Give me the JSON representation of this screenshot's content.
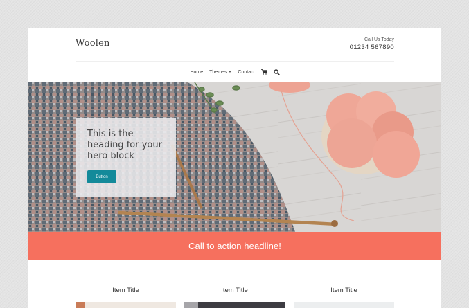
{
  "header": {
    "brand": "Woolen",
    "call_label": "Call Us Today",
    "phone": "01234 567890"
  },
  "nav": {
    "items": [
      {
        "label": "Home"
      },
      {
        "label": "Themes",
        "has_dropdown": true
      },
      {
        "label": "Contact"
      }
    ],
    "icons": [
      "cart-icon",
      "search-icon"
    ]
  },
  "hero": {
    "heading": "This is the heading for your hero block",
    "button_label": "Button"
  },
  "cta": {
    "headline": "Call to action headline!"
  },
  "items": [
    {
      "title": "Item Title"
    },
    {
      "title": "Item Title"
    },
    {
      "title": "Item Title"
    }
  ],
  "colors": {
    "accent": "#f6705e",
    "button": "#138a9a"
  }
}
